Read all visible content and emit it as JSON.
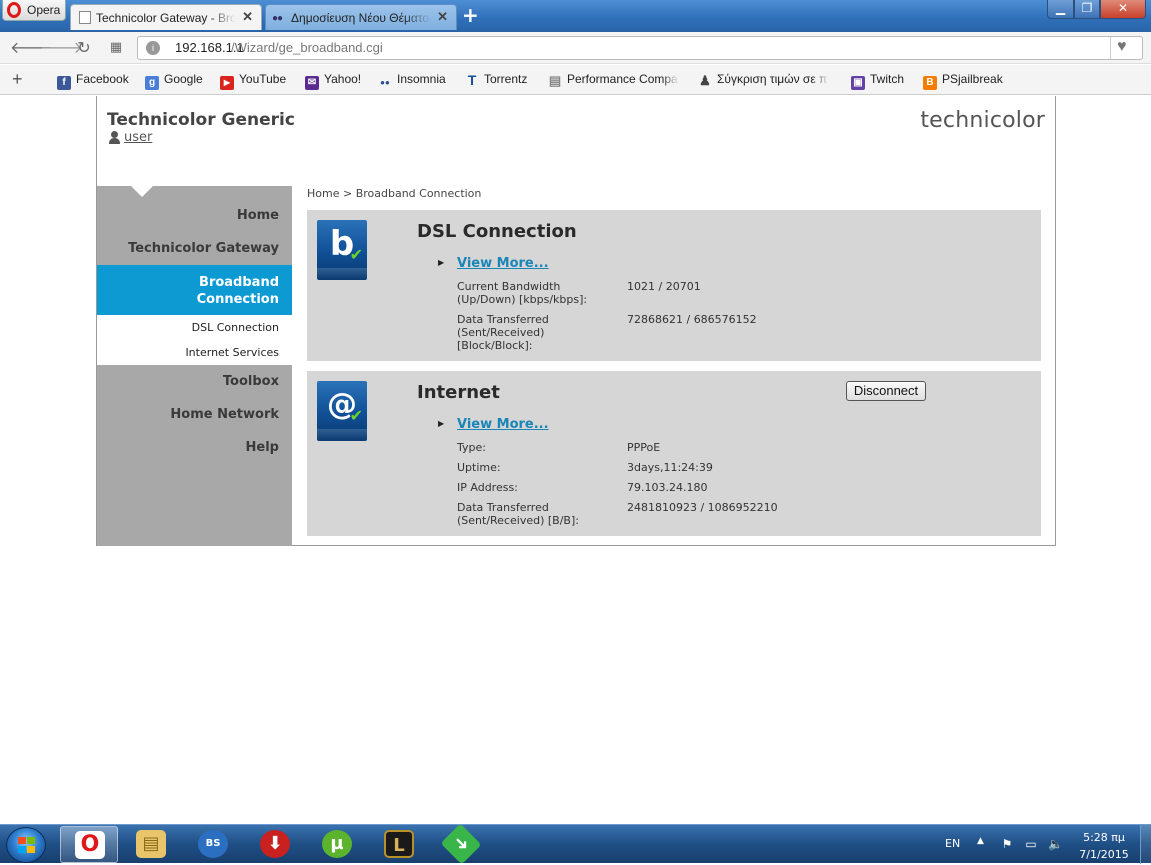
{
  "browser": {
    "menu_label": "Opera",
    "tabs": [
      {
        "title": "Technicolor Gateway - Broadband Connection"
      },
      {
        "title": "Δημοσίευση Νέου Θέματος"
      }
    ],
    "new_tab": "+",
    "window": {
      "minimize": "▁",
      "maximize": "❐",
      "close": "✕"
    },
    "address": {
      "host": "192.168.1.1",
      "path": "/Wizard/ge_broadband.cgi"
    },
    "bookmarks": [
      {
        "label": "Facebook",
        "icon": "facebook-icon",
        "color": "#3b5998",
        "glyph": "f"
      },
      {
        "label": "Google",
        "icon": "google-icon",
        "color": "#4a7fd8",
        "glyph": "g"
      },
      {
        "label": "YouTube",
        "icon": "youtube-icon",
        "color": "#d9251d",
        "glyph": "▶"
      },
      {
        "label": "Yahoo!",
        "icon": "yahoo-mail-icon",
        "color": "#5b2b91",
        "glyph": "✉"
      },
      {
        "label": "Insomnia",
        "icon": "insomnia-icon",
        "color": "#2b4b8a",
        "glyph": "●●"
      },
      {
        "label": "Torrentz",
        "icon": "torrentz-icon",
        "color": "#1a4f9c",
        "glyph": "T"
      },
      {
        "label": "Performance Compa",
        "icon": "page-icon",
        "color": "#888888",
        "glyph": "▤"
      },
      {
        "label": "Σύγκριση τιμών σε π",
        "icon": "skroutz-icon",
        "color": "#444444",
        "glyph": "♟"
      },
      {
        "label": "Twitch",
        "icon": "twitch-icon",
        "color": "#6441a5",
        "glyph": "▣"
      },
      {
        "label": "PSjailbreak",
        "icon": "blogger-icon",
        "color": "#f57d00",
        "glyph": "B"
      }
    ]
  },
  "page": {
    "site_title": "Technicolor Generic",
    "user_link": "user",
    "brand": "technicolor",
    "breadcrumb": "Home > Broadband Connection",
    "sidebar": {
      "home": "Home",
      "gateway": "Technicolor Gateway",
      "broadband_line1": "Broadband",
      "broadband_line2": "Connection",
      "dsl": "DSL Connection",
      "internet_services": "Internet Services",
      "toolbox": "Toolbox",
      "home_network": "Home Network",
      "help": "Help"
    },
    "dsl": {
      "title": "DSL Connection",
      "view_more": "View More...",
      "bandwidth_label_1": "Current Bandwidth",
      "bandwidth_label_2": "(Up/Down) [kbps/kbps]:",
      "bandwidth_value": "1021 / 20701",
      "transfer_label_1": "Data Transferred",
      "transfer_label_2": "(Sent/Received)",
      "transfer_label_3": "[Block/Block]:",
      "transfer_value": "72868621 / 686576152"
    },
    "internet": {
      "title": "Internet",
      "view_more": "View More...",
      "disconnect": "Disconnect",
      "type_label": "Type:",
      "type_value": "PPPoE",
      "uptime_label": "Uptime:",
      "uptime_value": "3days,11:24:39",
      "ip_label": "IP Address:",
      "ip_value": "79.103.24.180",
      "transfer_label_1": "Data Transferred",
      "transfer_label_2": "(Sent/Received) [B/B]:",
      "transfer_value": "2481810923 / 1086952210"
    }
  },
  "taskbar": {
    "language": "EN",
    "time": "5:28 πμ",
    "date": "7/1/2015",
    "apps": [
      "opera",
      "file-explorer",
      "bluestacks",
      "video-downloader",
      "utorrent",
      "league-of-legends",
      "download-manager"
    ]
  }
}
